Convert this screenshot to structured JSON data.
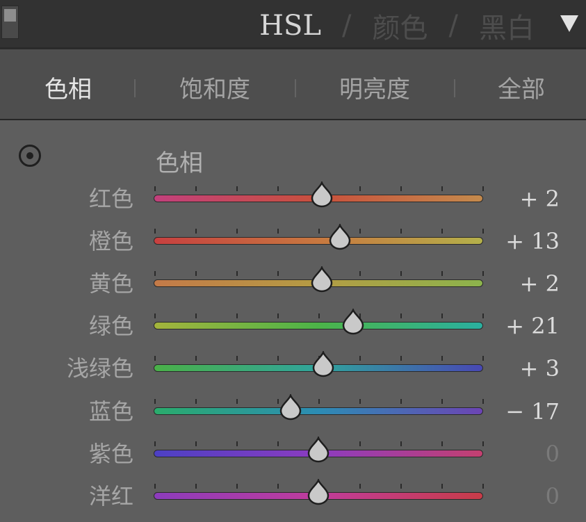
{
  "header": {
    "title": "HSL",
    "separator": "/",
    "tab_color": "颜色",
    "tab_bw": "黑白"
  },
  "subtabs": [
    {
      "label": "色相",
      "active": true
    },
    {
      "label": "饱和度",
      "active": false
    },
    {
      "label": "明亮度",
      "active": false
    },
    {
      "label": "全部",
      "active": false
    }
  ],
  "section": {
    "title": "色相",
    "target_icon": "target-adjustment-icon"
  },
  "sliders": [
    {
      "label": "红色",
      "value": "+ 2",
      "amount": 2,
      "gradient": [
        "#c2407c",
        "#c8503c",
        "#c48a4c"
      ]
    },
    {
      "label": "橙色",
      "value": "+ 13",
      "amount": 13,
      "gradient": [
        "#c84040",
        "#c87840",
        "#b4b04a"
      ]
    },
    {
      "label": "黄色",
      "value": "+ 2",
      "amount": 2,
      "gradient": [
        "#c47a48",
        "#b49c44",
        "#8cb44c"
      ]
    },
    {
      "label": "绿色",
      "value": "+ 21",
      "amount": 21,
      "gradient": [
        "#a4b43c",
        "#4cb448",
        "#2ab0a0"
      ]
    },
    {
      "label": "浅绿色",
      "value": "+ 3",
      "amount": 3,
      "gradient": [
        "#4ab048",
        "#30a49c",
        "#4848b4"
      ]
    },
    {
      "label": "蓝色",
      "value": "− 17",
      "amount": -17,
      "gradient": [
        "#2aac6c",
        "#2c8cb4",
        "#6c44b4"
      ]
    },
    {
      "label": "紫色",
      "value": "0",
      "amount": 0,
      "gradient": [
        "#4c40c4",
        "#8c3cc0",
        "#c44070"
      ]
    },
    {
      "label": "洋红",
      "value": "0",
      "amount": 0,
      "gradient": [
        "#8c3cbc",
        "#c03c9c",
        "#c83c48"
      ]
    }
  ],
  "colors": {
    "header_bg": "#323232",
    "panel_bg": "#5e5e5e",
    "subtab_bg": "#4e4e4e"
  }
}
